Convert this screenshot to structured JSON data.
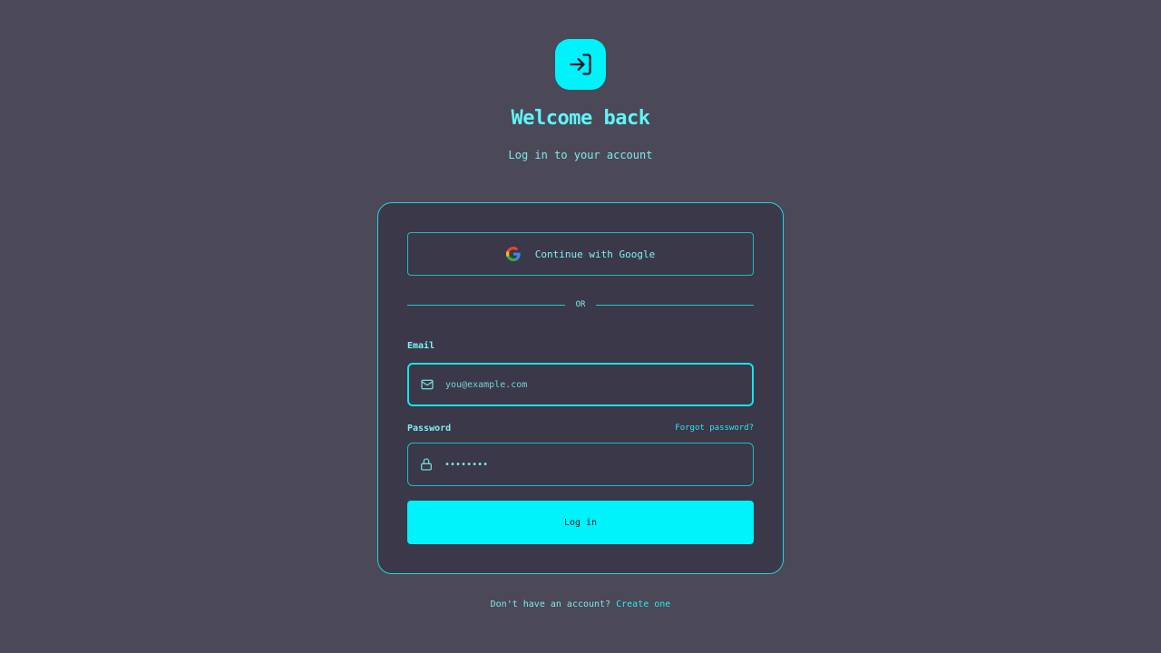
{
  "header": {
    "logo_icon": "login-icon",
    "title": "Welcome back",
    "subtitle": "Log in to your account"
  },
  "card": {
    "google_button": {
      "label": "Continue with Google",
      "icon": "google-icon"
    },
    "divider_text": "OR",
    "email": {
      "label": "Email",
      "placeholder": "you@example.com",
      "value": "",
      "icon": "mail-icon"
    },
    "password": {
      "label": "Password",
      "forgot_label": "Forgot password?",
      "value": "••••••••",
      "icon": "lock-icon"
    },
    "login_button": {
      "label": "Log in"
    }
  },
  "footer": {
    "prompt": "Don't have an account?",
    "link": "Create one"
  },
  "colors": {
    "background": "#4b4858",
    "card": "#3b3849",
    "accent": "#00f2fb"
  }
}
